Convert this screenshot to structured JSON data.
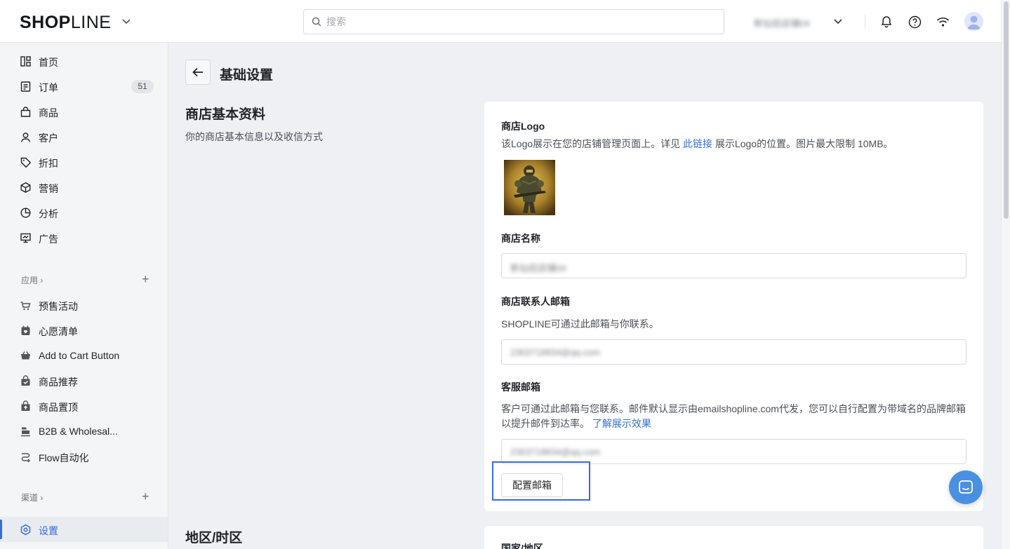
{
  "header": {
    "logo_bold": "SHOP",
    "logo_thin": "LINE",
    "search_placeholder": "搜索",
    "store_name": "新仙侣店铺04",
    "icons": [
      "chevron-down-icon",
      "search-icon",
      "bell-icon",
      "help-icon",
      "wifi-icon",
      "avatar-icon"
    ]
  },
  "sidebar": {
    "items": [
      {
        "label": "首页",
        "icon": "home-icon"
      },
      {
        "label": "订单",
        "icon": "order-icon",
        "badge": "51"
      },
      {
        "label": "商品",
        "icon": "bag-icon"
      },
      {
        "label": "客户",
        "icon": "user-icon"
      },
      {
        "label": "折扣",
        "icon": "tag-icon"
      },
      {
        "label": "营销",
        "icon": "box-icon"
      },
      {
        "label": "分析",
        "icon": "pie-icon"
      },
      {
        "label": "广告",
        "icon": "ad-icon"
      }
    ],
    "apps_title": "应用 ›",
    "apps": [
      {
        "label": "预售活动",
        "icon": "presale-icon"
      },
      {
        "label": "心愿清单",
        "icon": "wishlist-icon"
      },
      {
        "label": "Add to Cart Button",
        "icon": "cart-icon"
      },
      {
        "label": "商品推荐",
        "icon": "recommend-icon"
      },
      {
        "label": "商品置顶",
        "icon": "pin-icon"
      },
      {
        "label": "B2B & Wholesal...",
        "icon": "b2b-icon"
      },
      {
        "label": "Flow自动化",
        "icon": "flow-icon"
      }
    ],
    "channels_title": "渠道 ›",
    "settings_label": "设置"
  },
  "main": {
    "page_title": "基础设置",
    "section1": {
      "title": "商店基本资料",
      "desc": "你的商店基本信息以及收信方式"
    },
    "logo": {
      "label": "商店Logo",
      "help_prefix": "该Logo展示在您的店铺管理页面上。详见",
      "help_link": "此链接",
      "help_suffix": "展示Logo的位置。图片最大限制 10MB。"
    },
    "store_name": {
      "label": "商店名称",
      "value": "新仙侣店铺04"
    },
    "contact_email": {
      "label": "商店联系人邮箱",
      "help": "SHOPLINE可通过此邮箱与你联系。",
      "value": "2363718834@qq.com"
    },
    "service_email": {
      "label": "客服邮箱",
      "help": "客户可通过此邮箱与您联系。邮件默认显示由emailshopline.com代发，您可以自行配置为带域名的品牌邮箱以提升邮件到达率。",
      "help_link": "了解展示效果",
      "value": "2363718834@qq.com",
      "config_button": "配置邮箱"
    },
    "section2": {
      "title": "地区/时区",
      "first_label": "国家/地区"
    }
  },
  "colors": {
    "accent": "#356dd9",
    "chat": "#4a90e2"
  }
}
